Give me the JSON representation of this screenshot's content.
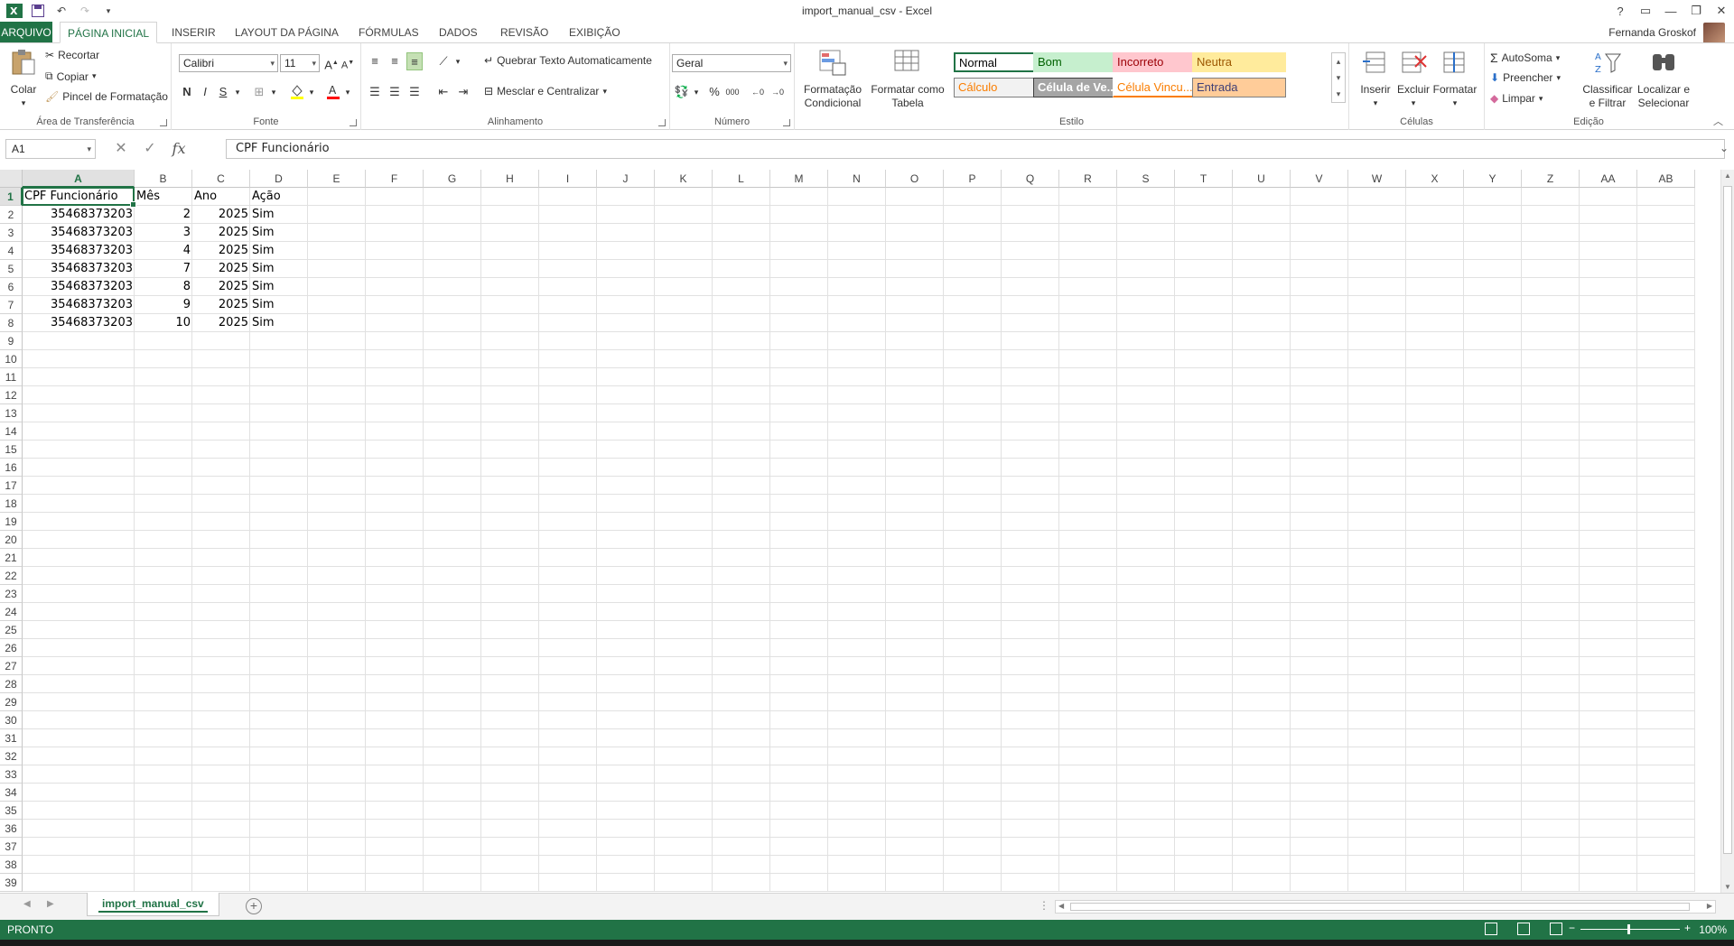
{
  "window": {
    "title": "import_manual_csv - Excel",
    "user": "Fernanda Groskof"
  },
  "tabs": [
    {
      "label": "ARQUIVO"
    },
    {
      "label": "PÁGINA INICIAL"
    },
    {
      "label": "INSERIR"
    },
    {
      "label": "LAYOUT DA PÁGINA"
    },
    {
      "label": "FÓRMULAS"
    },
    {
      "label": "DADOS"
    },
    {
      "label": "REVISÃO"
    },
    {
      "label": "EXIBIÇÃO"
    }
  ],
  "ribbon": {
    "clipboard": {
      "label": "Área de Transferência",
      "paste": "Colar",
      "cut": "Recortar",
      "copy": "Copiar",
      "format_painter": "Pincel de Formatação"
    },
    "font": {
      "label": "Fonte",
      "font_name": "Calibri",
      "font_size": "11"
    },
    "alignment": {
      "label": "Alinhamento",
      "wrap_text": "Quebrar Texto Automaticamente",
      "merge_center": "Mesclar e Centralizar"
    },
    "number": {
      "label": "Número",
      "format": "Geral"
    },
    "styles": {
      "label": "Estilo",
      "conditional_formatting": "Formatação Condicional",
      "format_as_table": "Formatar como Tabela",
      "gallery": [
        {
          "name": "Normal",
          "bg": "#ffffff",
          "fg": "#000000",
          "border": "#217346"
        },
        {
          "name": "Bom",
          "bg": "#c6efce",
          "fg": "#006100",
          "border": "#c6efce"
        },
        {
          "name": "Incorreto",
          "bg": "#ffc7ce",
          "fg": "#9c0006",
          "border": "#ffc7ce"
        },
        {
          "name": "Neutra",
          "bg": "#ffeb9c",
          "fg": "#9c5700",
          "border": "#ffeb9c"
        },
        {
          "name": "Cálculo",
          "bg": "#f2f2f2",
          "fg": "#fa7d00",
          "border": "#7f7f7f"
        },
        {
          "name": "Célula de Ve...",
          "bg": "#a5a5a5",
          "fg": "#ffffff",
          "border": "#3f3f3f"
        },
        {
          "name": "Célula Vincu...",
          "bg": "#ffffff",
          "fg": "#fa7d00",
          "border": "#ffffff"
        },
        {
          "name": "Entrada",
          "bg": "#ffcc99",
          "fg": "#3f3f76",
          "border": "#7f7f7f"
        }
      ]
    },
    "cells": {
      "label": "Células",
      "insert": "Inserir",
      "delete": "Excluir",
      "format": "Formatar"
    },
    "editing": {
      "label": "Edição",
      "autosum": "AutoSoma",
      "fill": "Preencher",
      "clear": "Limpar",
      "sort_filter": "Classificar e Filtrar",
      "find_select": "Localizar e Selecionar"
    }
  },
  "formula_bar": {
    "name_box": "A1",
    "fx": "fx",
    "content": "CPF Funcionário"
  },
  "grid": {
    "columns": [
      "A",
      "B",
      "C",
      "D",
      "E",
      "F",
      "G",
      "H",
      "I",
      "J",
      "K",
      "L",
      "M",
      "N",
      "O",
      "P",
      "Q",
      "R",
      "S",
      "T",
      "U",
      "V",
      "W",
      "X",
      "Y",
      "Z",
      "AA",
      "AB"
    ],
    "row_count": 39,
    "rows": [
      [
        "CPF Funcionário",
        "Mês",
        "Ano",
        "Ação"
      ],
      [
        "35468373203",
        "2",
        "2025",
        "Sim"
      ],
      [
        "35468373203",
        "3",
        "2025",
        "Sim"
      ],
      [
        "35468373203",
        "4",
        "2025",
        "Sim"
      ],
      [
        "35468373203",
        "7",
        "2025",
        "Sim"
      ],
      [
        "35468373203",
        "8",
        "2025",
        "Sim"
      ],
      [
        "35468373203",
        "9",
        "2025",
        "Sim"
      ],
      [
        "35468373203",
        "10",
        "2025",
        "Sim"
      ]
    ]
  },
  "sheets": [
    {
      "name": "import_manual_csv",
      "active": true
    }
  ],
  "status": {
    "text": "PRONTO",
    "zoom": "100%"
  },
  "colors": {
    "accent": "#217346"
  }
}
